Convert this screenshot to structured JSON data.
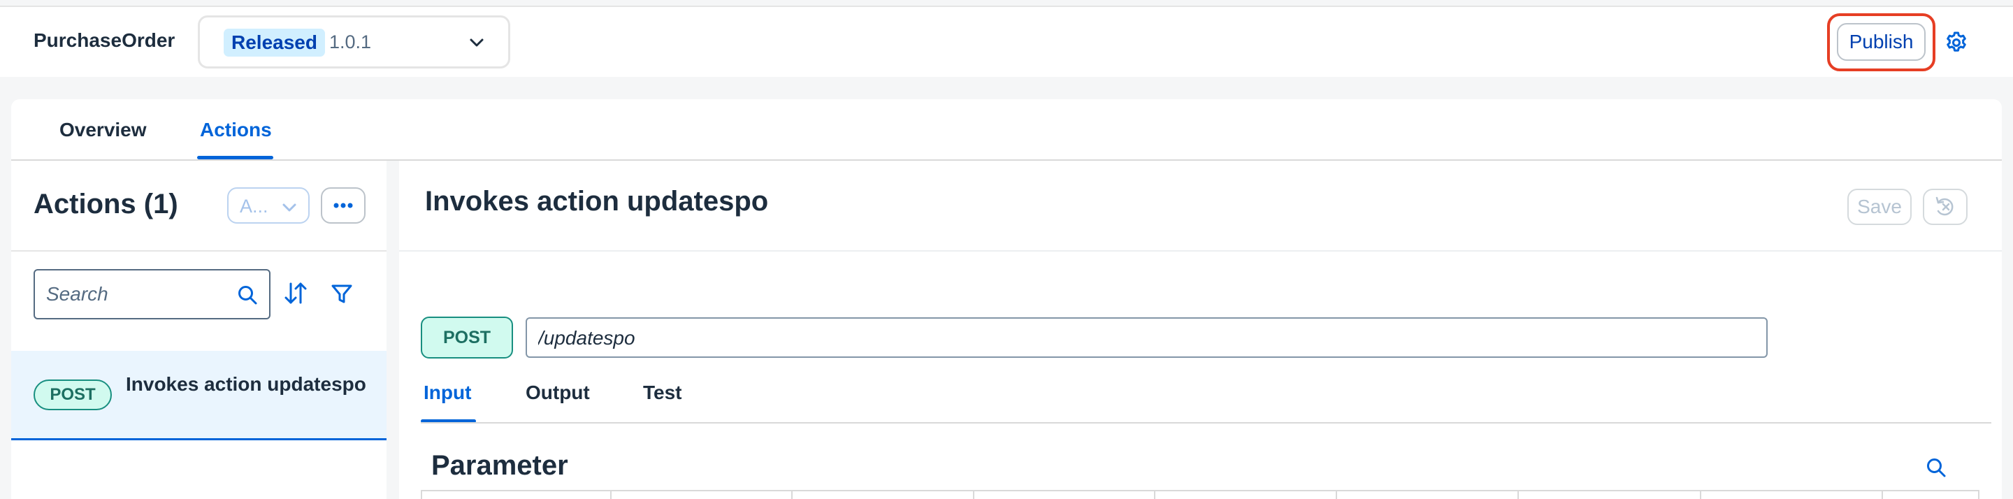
{
  "app": {
    "title": "PurchaseOrder"
  },
  "version_select": {
    "status": "Released",
    "version": "1.0.1",
    "icon": "chevron-down-icon"
  },
  "header": {
    "publish_label": "Publish",
    "settings_icon": "gear-icon"
  },
  "tabs": [
    {
      "label": "Overview",
      "active": false
    },
    {
      "label": "Actions",
      "active": true
    }
  ],
  "list": {
    "title": "Actions (1)",
    "filter_value": "A...",
    "more_icon": "more-icon",
    "search_placeholder": "Search",
    "items": [
      {
        "method": "POST",
        "label": "Invokes action updatespo",
        "selected": true
      }
    ]
  },
  "detail": {
    "title": "Invokes action updatespo",
    "save_label": "Save",
    "revert_icon": "revert-icon",
    "method": "POST",
    "path": "/updatespo",
    "sub_tabs": [
      {
        "label": "Input",
        "active": true
      },
      {
        "label": "Output",
        "active": false
      },
      {
        "label": "Test",
        "active": false
      }
    ],
    "section_title": "Parameter"
  },
  "colors": {
    "accent": "#0064d9",
    "badge_bg": "#d1efff",
    "method_bg": "#d1faef",
    "method_border": "#188f80",
    "highlight_outline": "#e63e24"
  }
}
